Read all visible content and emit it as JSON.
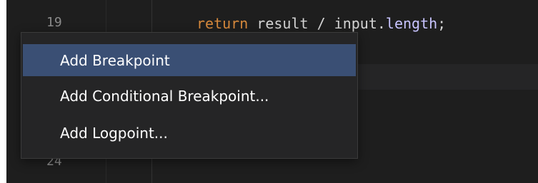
{
  "editor": {
    "line_numbers": {
      "top": "19",
      "bottom": "24"
    },
    "code": {
      "keyword": "return",
      "middle": " result / input.",
      "property": "length",
      "end": ";"
    }
  },
  "context_menu": {
    "items": [
      {
        "label": "Add Breakpoint"
      },
      {
        "label": "Add Conditional Breakpoint..."
      },
      {
        "label": "Add Logpoint..."
      }
    ]
  },
  "colors": {
    "editor_background": "#1e1e1e",
    "menu_background": "#252526",
    "menu_highlight": "#3a4f74",
    "keyword": "#d7893c",
    "property": "#c8c4ff"
  }
}
